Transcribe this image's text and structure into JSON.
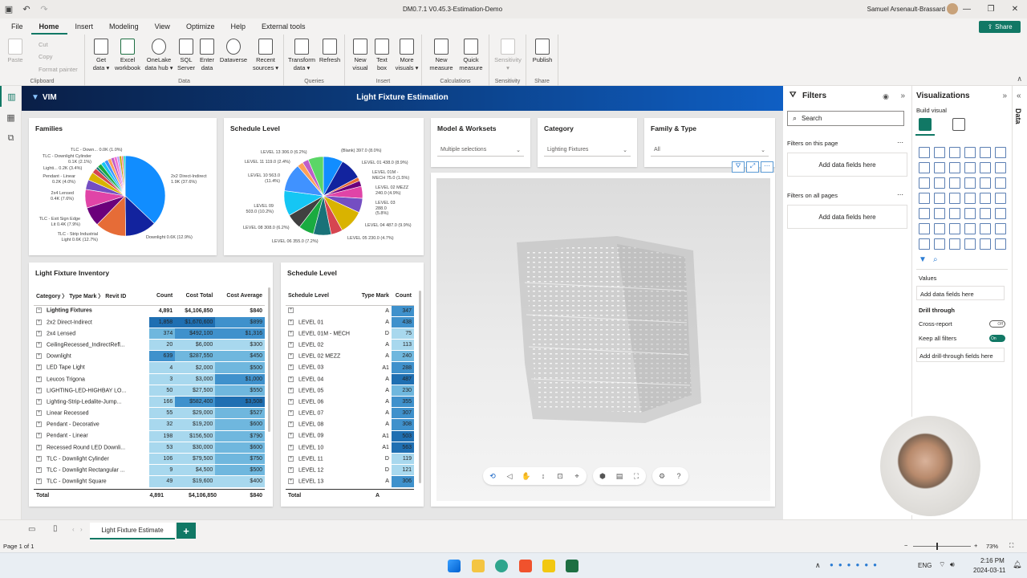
{
  "window": {
    "title": "DM0.7.1 V0.45.3-Estimation-Demo",
    "user": "Samuel Arsenault-Brassard"
  },
  "menu": {
    "items": [
      "File",
      "Home",
      "Insert",
      "Modeling",
      "View",
      "Optimize",
      "Help",
      "External tools"
    ],
    "active": "Home",
    "share_label": "Share"
  },
  "ribbon": {
    "clipboard": {
      "paste": "Paste",
      "cut": "Cut",
      "copy": "Copy",
      "format_painter": "Format painter",
      "label": "Clipboard"
    },
    "data": {
      "label": "Data",
      "buttons": [
        "Get data ▾",
        "Excel workbook",
        "OneLake data hub ▾",
        "SQL Server",
        "Enter data",
        "Dataverse",
        "Recent sources ▾"
      ]
    },
    "queries": {
      "label": "Queries",
      "buttons": [
        "Transform data ▾",
        "Refresh"
      ]
    },
    "insert": {
      "label": "Insert",
      "buttons": [
        "New visual",
        "Text box",
        "More visuals ▾"
      ]
    },
    "calculations": {
      "label": "Calculations",
      "buttons": [
        "New measure",
        "Quick measure"
      ]
    },
    "sensitivity": {
      "label": "Sensitivity",
      "buttons": [
        "Sensitivity ▾"
      ]
    },
    "share": {
      "label": "Share",
      "buttons": [
        "Publish"
      ]
    }
  },
  "report": {
    "logo": "VIM",
    "title": "Light Fixture Estimation"
  },
  "cards": {
    "families_title": "Families",
    "schedule_pie_title": "Schedule Level",
    "model_title": "Model & Worksets",
    "model_value": "Multiple selections",
    "category_title": "Category",
    "category_value": "Lighting Fixtures",
    "family_type_title": "Family & Type",
    "family_type_value": "All",
    "inventory_title": "Light Fixture Inventory",
    "schedule_table_title": "Schedule Level"
  },
  "families_pie_labels": [
    "TLC - Down... 0.0K (1.0%)",
    "TLC - Downlight Cylinder 0.1K (2.1%)",
    "Lighti... 0.2K (3.4%)",
    "Pendant - Linear 0.2K (4.0%)",
    "2x4 Lensed 0.4K (7.6%)",
    "TLC - Exit Sign Edge Lit 0.4K (7.9%)",
    "TLC - Strip Industrial Light 0.6K (12.7%)",
    "Downlight 0.6K (12.9%)",
    "2x2 Direct-Indirect 1.9K (37.6%)"
  ],
  "schedule_pie_labels": [
    "LEVEL 13 306.0 (6.2%)",
    "LEVEL 11 119.0 (2.4%)",
    "LEVEL 10 563.0 (11.4%)",
    "LEVEL 09 503.0 (10.2%)",
    "LEVEL 08 308.0 (6.2%)",
    "LEVEL 06 355.0 (7.2%)",
    "(Blank) 397.0 (8.0%)",
    "LEVEL 01 438.0 (8.9%)",
    "LEVEL 01M - MECH 75.0 (1.5%)",
    "LEVEL 02 MEZZ 240.0 (4.9%)",
    "LEVEL 03 288.0 (5.8%)",
    "LEVEL 04 487.0 (9.9%)",
    "LEVEL 05 230.0 (4.7%)"
  ],
  "inventory": {
    "headers": [
      "Category 〉 Type Mark 〉 Revit ID",
      "Count",
      "Cost Total",
      "Cost Average"
    ],
    "subtotal": [
      "Lighting Fixtures",
      "4,891",
      "$4,106,850",
      "$840"
    ],
    "rows": [
      [
        "2x2 Direct-Indirect",
        "1,858",
        "$1,670,600",
        "$899"
      ],
      [
        "2x4 Lensed",
        "374",
        "$492,100",
        "$1,316"
      ],
      [
        "CeilingRecessed_IndirectRefl...",
        "20",
        "$6,000",
        "$300"
      ],
      [
        "Downlight",
        "639",
        "$287,550",
        "$450"
      ],
      [
        "LED Tape Light",
        "4",
        "$2,000",
        "$500"
      ],
      [
        "Leucos Trigona",
        "3",
        "$3,000",
        "$1,000"
      ],
      [
        "LIGHTING-LED-HIGHBAY LO...",
        "50",
        "$27,500",
        "$550"
      ],
      [
        "Lighting-Strip-Ledalite-Jump...",
        "166",
        "$582,400",
        "$3,508"
      ],
      [
        "Linear Recessed",
        "55",
        "$29,000",
        "$527"
      ],
      [
        "Pendant - Decorative",
        "32",
        "$19,200",
        "$600"
      ],
      [
        "Pendant - Linear",
        "198",
        "$156,500",
        "$790"
      ],
      [
        "Recessed Round LED Downli...",
        "53",
        "$30,000",
        "$600"
      ],
      [
        "TLC - Downlight Cylinder",
        "106",
        "$79,500",
        "$750"
      ],
      [
        "TLC - Downlight Rectangular ...",
        "9",
        "$4,500",
        "$500"
      ],
      [
        "TLC - Downlight Square",
        "49",
        "$19,600",
        "$400"
      ]
    ],
    "total": [
      "Total",
      "4,891",
      "$4,106,850",
      "$840"
    ]
  },
  "schedule_table": {
    "headers": [
      "Schedule Level",
      "Type Mark",
      "Count"
    ],
    "rows": [
      [
        "",
        "A",
        "347"
      ],
      [
        "LEVEL 01",
        "A",
        "438"
      ],
      [
        "LEVEL 01M - MECH",
        "D",
        "75"
      ],
      [
        "LEVEL 02",
        "A",
        "113"
      ],
      [
        "LEVEL 02 MEZZ",
        "A",
        "240"
      ],
      [
        "LEVEL 03",
        "A1",
        "288"
      ],
      [
        "LEVEL 04",
        "A",
        "487"
      ],
      [
        "LEVEL 05",
        "A",
        "230"
      ],
      [
        "LEVEL 06",
        "A",
        "355"
      ],
      [
        "LEVEL 07",
        "A",
        "307"
      ],
      [
        "LEVEL 08",
        "A",
        "308"
      ],
      [
        "LEVEL 09",
        "A1",
        "503"
      ],
      [
        "LEVEL 10",
        "A1",
        "563"
      ],
      [
        "LEVEL 11",
        "D",
        "119"
      ],
      [
        "LEVEL 12",
        "D",
        "121"
      ],
      [
        "LEVEL 13",
        "A",
        "306"
      ]
    ],
    "total": [
      "Total",
      "A",
      ""
    ]
  },
  "filters": {
    "title": "Filters",
    "search_placeholder": "Search",
    "on_page": "Filters on this page",
    "on_all_pages": "Filters on all pages",
    "add_fields": "Add data fields here"
  },
  "visualizations": {
    "title": "Visualizations",
    "build": "Build visual",
    "values": "Values",
    "add_fields": "Add data fields here",
    "drill_through": "Drill through",
    "cross_report": "Cross-report",
    "cross_report_state": "Off",
    "keep_filters": "Keep all filters",
    "keep_filters_state": "On",
    "add_drill": "Add drill-through fields here",
    "data_tab": "Data"
  },
  "tabs": {
    "page_name": "Light Fixture Estimate",
    "add": "+"
  },
  "status": {
    "page": "Page 1 of 1",
    "zoom": "73%"
  },
  "taskbar": {
    "lang": "ENG",
    "time": "2:16 PM",
    "date": "2024-03-11"
  },
  "colors": {
    "accent": "#117865",
    "header_dark": "#0a1f47",
    "header_light": "#0f5fc4",
    "heat_dark": "#1f6fb2",
    "heat_mid": "#5aaed8",
    "heat_light": "#a8d8ee"
  }
}
